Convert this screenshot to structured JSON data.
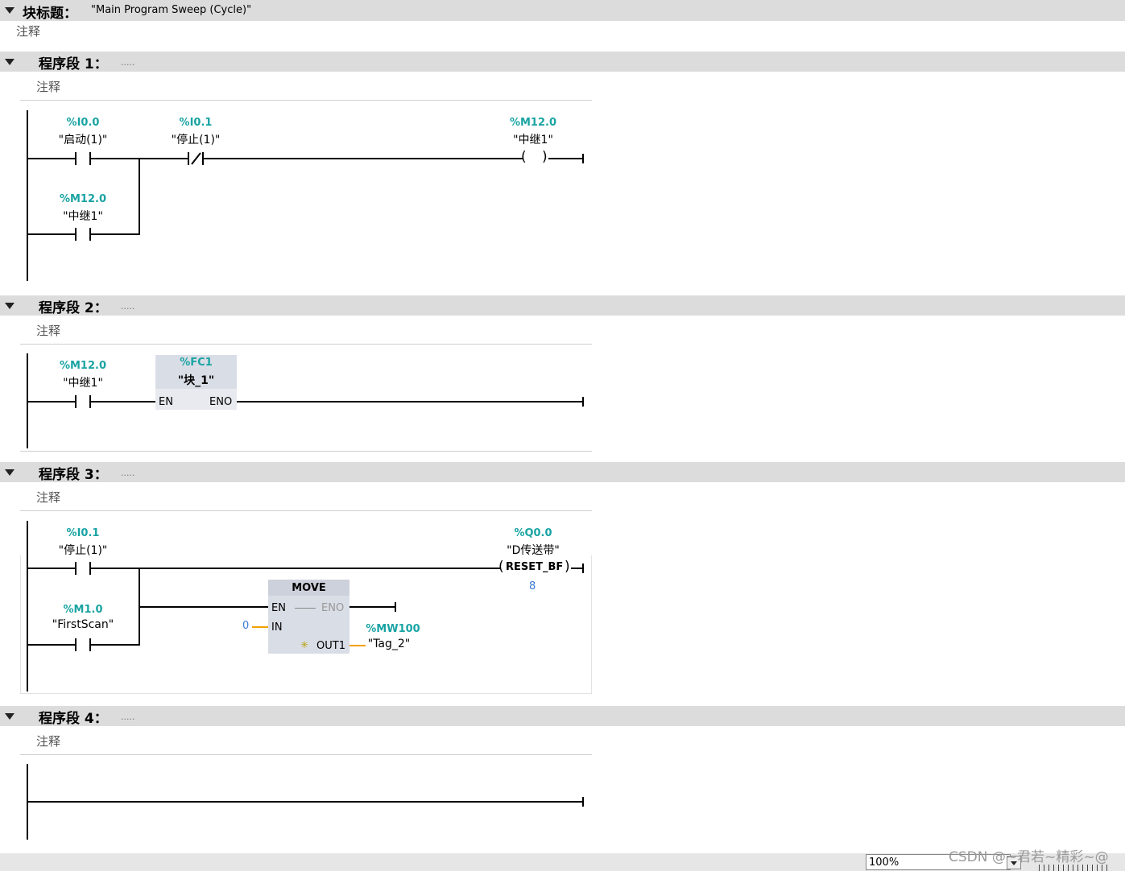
{
  "block": {
    "title_label": "块标题：",
    "title_value": "\"Main Program Sweep (Cycle)\"",
    "comment": "注释"
  },
  "segments": [
    {
      "header": "程序段 1：",
      "dots": ".....",
      "comment": "注释",
      "contact_a_addr": "%I0.0",
      "contact_a_tag": "\"启动(1)\"",
      "contact_b_addr": "%I0.1",
      "contact_b_tag": "\"停止(1)\"",
      "coil_addr": "%M12.0",
      "coil_tag": "\"中继1\"",
      "contact_c_addr": "%M12.0",
      "contact_c_tag": "\"中继1\""
    },
    {
      "header": "程序段 2：",
      "dots": ".....",
      "comment": "注释",
      "contact_addr": "%M12.0",
      "contact_tag": "\"中继1\"",
      "fc_addr": "%FC1",
      "fc_name": "\"块_1\"",
      "pin_en": "EN",
      "pin_eno": "ENO"
    },
    {
      "header": "程序段 3：",
      "dots": ".....",
      "comment": "注释",
      "contact_a_addr": "%I0.1",
      "contact_a_tag": "\"停止(1)\"",
      "contact_b_addr": "%M1.0",
      "contact_b_tag": "\"FirstScan\"",
      "coil_addr": "%Q0.0",
      "coil_tag": "\"D传送带\"",
      "coil_label": "RESET_BF",
      "coil_count": "8",
      "move_title": "MOVE",
      "pin_en": "EN",
      "pin_eno": "ENO",
      "pin_in": "IN",
      "pin_out": "OUT1",
      "in_value": "0",
      "out_addr": "%MW100",
      "out_tag": "\"Tag_2\""
    },
    {
      "header": "程序段 4：",
      "dots": ".....",
      "comment": "注释"
    }
  ],
  "status": {
    "zoom": "100%",
    "watermark": "CSDN @~君若~精彩~@"
  },
  "colors": {
    "address": "#1aa3a3",
    "header_bg": "#dcdcdc",
    "fb_bg": "#d9dde6",
    "connector": "#f3a100"
  }
}
